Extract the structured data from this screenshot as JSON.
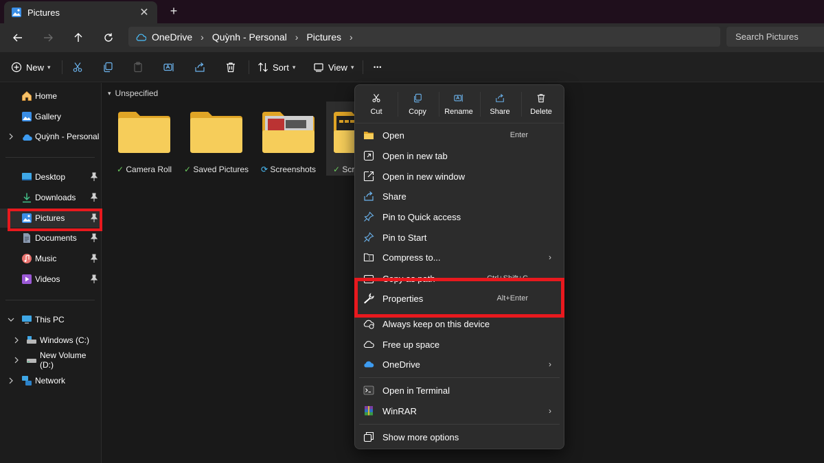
{
  "window": {
    "tab_title": "Pictures",
    "close_glyph": "✕",
    "new_tab_glyph": "+"
  },
  "address": {
    "crumbs": [
      "OneDrive",
      "Quỳnh - Personal",
      "Pictures"
    ],
    "search_placeholder": "Search Pictures"
  },
  "toolbar": {
    "new_label": "New",
    "sort_label": "Sort",
    "view_label": "View",
    "more_glyph": "•••"
  },
  "sidebar": {
    "items": [
      {
        "label": "Home",
        "icon": "home-icon"
      },
      {
        "label": "Gallery",
        "icon": "gallery-icon"
      },
      {
        "label": "Quỳnh - Personal",
        "icon": "onedrive-cloud-icon"
      },
      {
        "label": "Desktop",
        "icon": "desktop-icon"
      },
      {
        "label": "Downloads",
        "icon": "download-icon"
      },
      {
        "label": "Pictures",
        "icon": "pictures-icon"
      },
      {
        "label": "Documents",
        "icon": "documents-icon"
      },
      {
        "label": "Music",
        "icon": "music-icon"
      },
      {
        "label": "Videos",
        "icon": "videos-icon"
      },
      {
        "label": "This PC",
        "icon": "pc-icon"
      },
      {
        "label": "Windows (C:)",
        "icon": "drive-icon"
      },
      {
        "label": "New Volume (D:)",
        "icon": "drive-icon"
      },
      {
        "label": "Network",
        "icon": "network-icon"
      }
    ]
  },
  "content": {
    "group_label": "Unspecified",
    "folders": [
      {
        "name": "Camera Roll",
        "status": "synced"
      },
      {
        "name": "Saved Pictures",
        "status": "synced"
      },
      {
        "name": "Screenshots",
        "status": "syncing"
      },
      {
        "name": "Scr",
        "status": "synced"
      }
    ]
  },
  "context_menu": {
    "quick_actions": [
      "Cut",
      "Copy",
      "Rename",
      "Share",
      "Delete"
    ],
    "items": [
      {
        "label": "Open",
        "shortcut": "Enter"
      },
      {
        "label": "Open in new tab",
        "shortcut": ""
      },
      {
        "label": "Open in new window",
        "shortcut": ""
      },
      {
        "label": "Share",
        "shortcut": ""
      },
      {
        "label": "Pin to Quick access",
        "shortcut": ""
      },
      {
        "label": "Pin to Start",
        "shortcut": ""
      },
      {
        "label": "Compress to...",
        "shortcut": ""
      },
      {
        "label": "Copy as path",
        "shortcut": "Ctrl+Shift+C"
      },
      {
        "label": "Properties",
        "shortcut": "Alt+Enter"
      },
      {
        "label": "Always keep on this device",
        "shortcut": ""
      },
      {
        "label": "Free up space",
        "shortcut": ""
      },
      {
        "label": "OneDrive",
        "shortcut": ""
      },
      {
        "label": "Open in Terminal",
        "shortcut": ""
      },
      {
        "label": "WinRAR",
        "shortcut": ""
      },
      {
        "label": "Show more options",
        "shortcut": ""
      }
    ],
    "submenu_arrow": "›"
  },
  "colors": {
    "highlight_red": "#e8191e",
    "folder_yellow": "#f4c542",
    "accent_blue": "#4cc2ff",
    "sync_green": "#6ccb5f"
  }
}
